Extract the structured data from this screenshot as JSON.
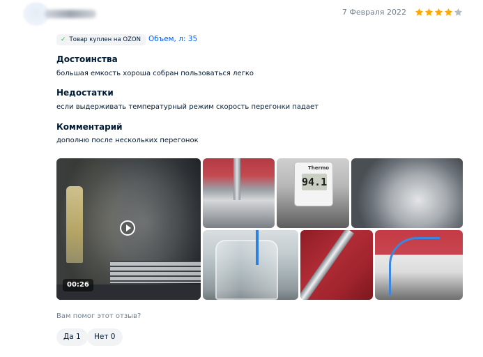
{
  "review": {
    "date": "7 Февраля 2022",
    "rating": 4,
    "rating_max": 5,
    "star_color_filled": "#ffa800",
    "star_color_empty": "#b3bcc5",
    "purchased_badge": "Товар куплен на OZON",
    "purchased_badge_icon": "check-icon",
    "volume": "Объем, л: 35",
    "sections": {
      "pros_title": "Достоинства",
      "pros_text": "большая емкость хороша собран пользоваться легко",
      "cons_title": "Недостатки",
      "cons_text": "если выдерживать температурный режим скорость перегонки падает",
      "comment_title": "Комментарий",
      "comment_text": "дополню после нескольких перегонок"
    },
    "media": {
      "video_duration": "00:26",
      "thermometer_brand": "Thermo",
      "thermometer_reading": "94.1"
    },
    "helpful": {
      "question": "Вам помог этот отзыв?",
      "yes_label": "Да 1",
      "no_label": "Нет 0"
    }
  },
  "colors": {
    "link": "#005bff",
    "check": "#10c44c",
    "muted_text": "#707f8d",
    "primary_text": "#001a34"
  }
}
